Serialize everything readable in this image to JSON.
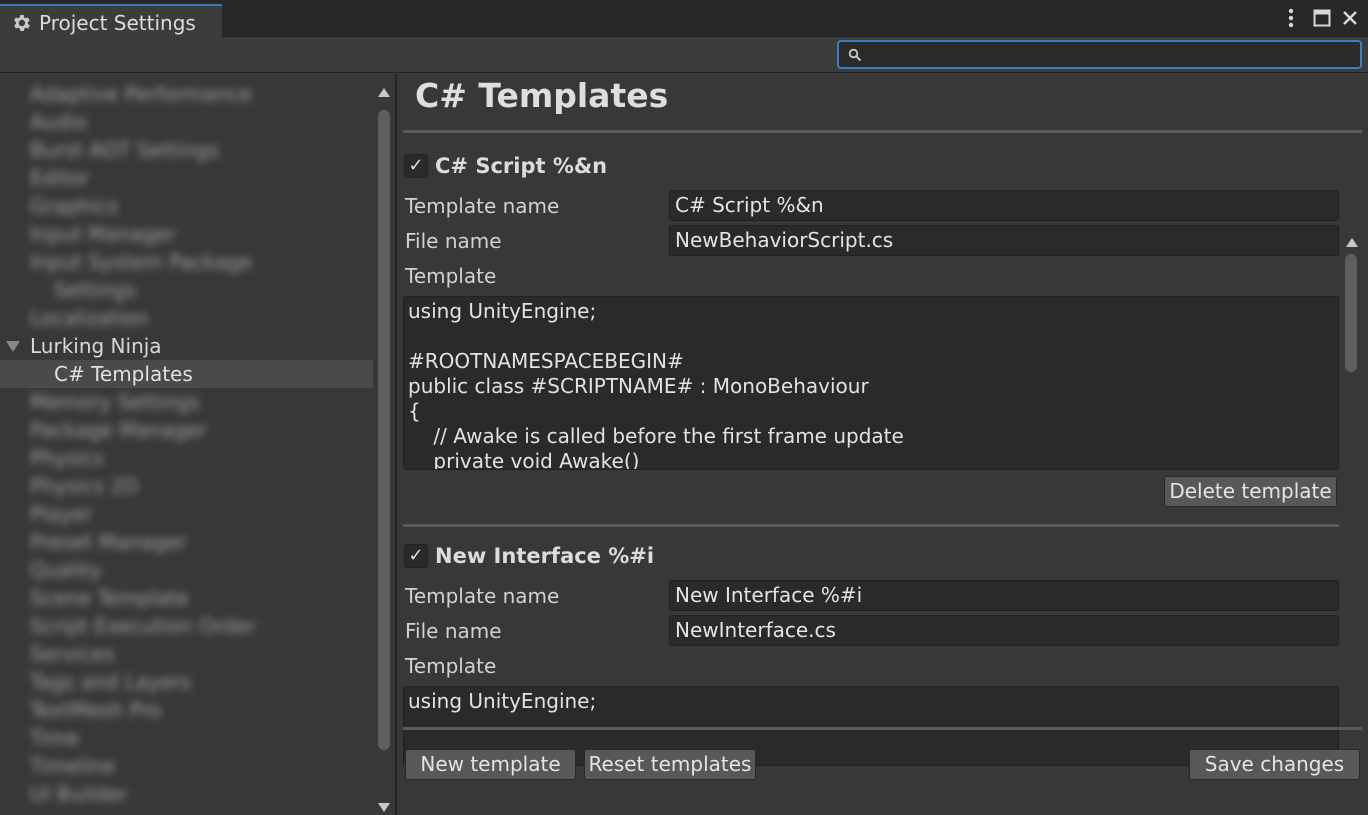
{
  "window": {
    "tab_title": "Project Settings"
  },
  "search": {
    "placeholder": "",
    "value": ""
  },
  "sidebar": {
    "items": [
      {
        "label": "Adaptive Performance",
        "blurred": true
      },
      {
        "label": "Audio",
        "blurred": true
      },
      {
        "label": "Burst AOT Settings",
        "blurred": true
      },
      {
        "label": "Editor",
        "blurred": true
      },
      {
        "label": "Graphics",
        "blurred": true
      },
      {
        "label": "Input Manager",
        "blurred": true
      },
      {
        "label": "Input System Package",
        "blurred": true
      },
      {
        "label": "Settings",
        "blurred": true
      },
      {
        "label": "Localization",
        "blurred": true
      },
      {
        "label": "Lurking Ninja",
        "blurred": false,
        "expanded": true
      },
      {
        "label": "C# Templates",
        "blurred": false,
        "selected": true
      },
      {
        "label": "Memory Settings",
        "blurred": true
      },
      {
        "label": "Package Manager",
        "blurred": true
      },
      {
        "label": "Physics",
        "blurred": true
      },
      {
        "label": "Physics 2D",
        "blurred": true
      },
      {
        "label": "Player",
        "blurred": true
      },
      {
        "label": "Preset Manager",
        "blurred": true
      },
      {
        "label": "Quality",
        "blurred": true
      },
      {
        "label": "Scene Template",
        "blurred": true
      },
      {
        "label": "Script Execution Order",
        "blurred": true
      },
      {
        "label": "Services",
        "blurred": true
      },
      {
        "label": "Tags and Layers",
        "blurred": true
      },
      {
        "label": "TextMesh Pro",
        "blurred": true
      },
      {
        "label": "Time",
        "blurred": true
      },
      {
        "label": "Timeline",
        "blurred": true
      },
      {
        "label": "UI Builder",
        "blurred": true
      }
    ]
  },
  "main": {
    "title": "C# Templates",
    "templates": [
      {
        "enabled": true,
        "header": "C# Script %&n",
        "template_name_label": "Template name",
        "template_name": "C# Script %&n",
        "file_name_label": "File name",
        "file_name": "NewBehaviorScript.cs",
        "template_label": "Template",
        "code": "using UnityEngine;\n\n#ROOTNAMESPACEBEGIN#\npublic class #SCRIPTNAME# : MonoBehaviour\n{\n    // Awake is called before the first frame update\n    private void Awake()",
        "delete_label": "Delete template"
      },
      {
        "enabled": true,
        "header": "New Interface %#i",
        "template_name_label": "Template name",
        "template_name": "New Interface %#i",
        "file_name_label": "File name",
        "file_name": "NewInterface.cs",
        "template_label": "Template",
        "code": "using UnityEngine;"
      }
    ],
    "footer": {
      "new_template": "New template",
      "reset_templates": "Reset templates",
      "save_changes": "Save changes"
    }
  },
  "colors": {
    "accent": "#3d7fc2",
    "background": "#383838",
    "field": "#2a2a2a"
  }
}
